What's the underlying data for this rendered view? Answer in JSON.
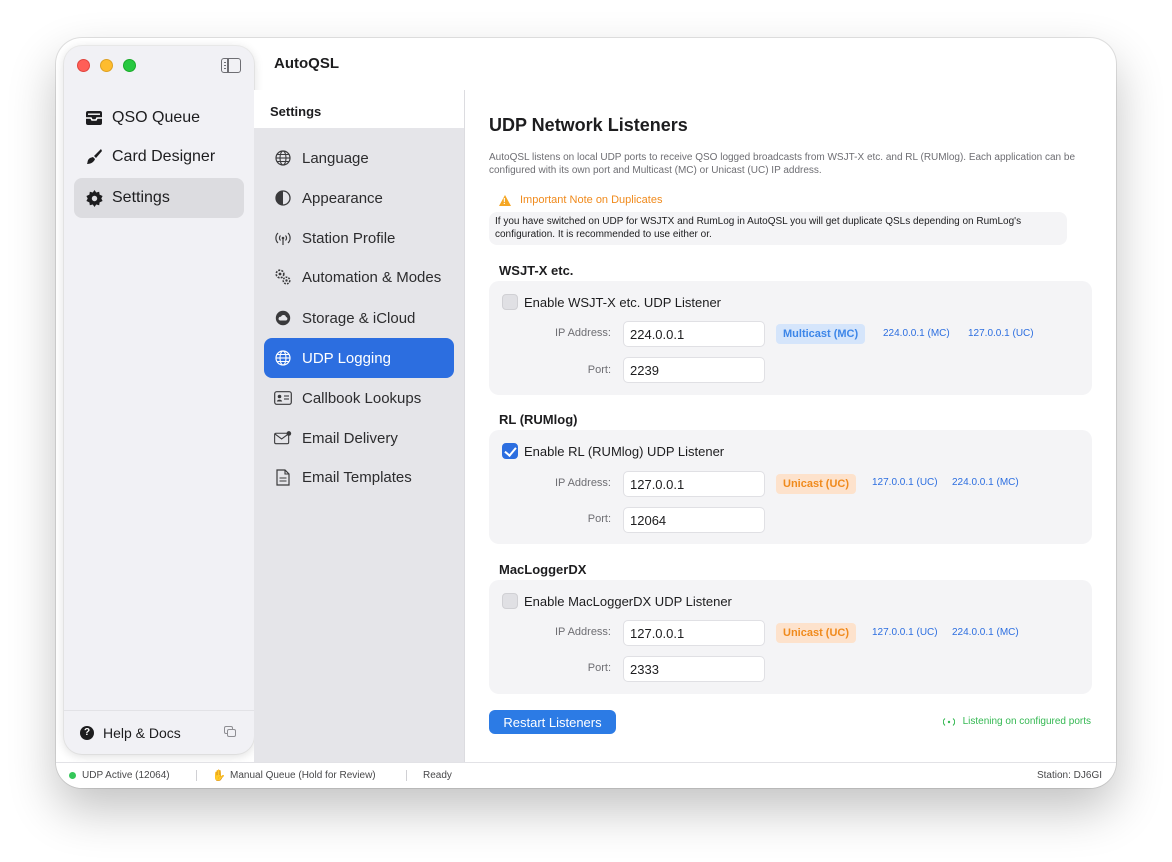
{
  "app": {
    "title": "AutoQSL"
  },
  "sidebar": {
    "items": [
      {
        "label": "QSO Queue",
        "icon": "tray-icon",
        "active": false
      },
      {
        "label": "Card Designer",
        "icon": "brush-icon",
        "active": false
      },
      {
        "label": "Settings",
        "icon": "gear-icon",
        "active": true
      }
    ],
    "footer": {
      "help_label": "Help & Docs"
    }
  },
  "settings": {
    "header": "Settings",
    "items": [
      {
        "label": "Language",
        "icon": "globe-icon"
      },
      {
        "label": "Appearance",
        "icon": "contrast-icon"
      },
      {
        "label": "Station Profile",
        "icon": "antenna-icon"
      },
      {
        "label": "Automation & Modes",
        "icon": "gears-icon"
      },
      {
        "label": "Storage & iCloud",
        "icon": "cloud-icon"
      },
      {
        "label": "UDP Logging",
        "icon": "network-icon",
        "active": true
      },
      {
        "label": "Callbook Lookups",
        "icon": "id-card-icon"
      },
      {
        "label": "Email Delivery",
        "icon": "envelope-icon"
      },
      {
        "label": "Email Templates",
        "icon": "document-icon"
      }
    ]
  },
  "main": {
    "title": "UDP Network Listeners",
    "description": "AutoQSL listens on local UDP ports to receive QSO logged broadcasts from WSJT-X etc. and RL (RUMlog). Each application can be configured with its own port and Multicast (MC) or Unicast (UC) IP address.",
    "note_title": "Important Note on Duplicates",
    "note_body": "If you have switched on UDP for WSJTX and RumLog in AutoQSL you will get duplicate QSLs depending on RumLog's configuration. It is recommended to use either or.",
    "ip_label": "IP Address:",
    "port_label": "Port:",
    "sections": [
      {
        "title": "WSJT-X etc.",
        "enable_label": "Enable WSJT-X etc. UDP Listener",
        "enabled": false,
        "ip": "224.0.0.1",
        "port": "2239",
        "mode_badge": "Multicast (MC)",
        "preset1": "224.0.0.1 (MC)",
        "preset2": "127.0.0.1 (UC)"
      },
      {
        "title": "RL (RUMlog)",
        "enable_label": "Enable RL (RUMlog) UDP Listener",
        "enabled": true,
        "ip": "127.0.0.1",
        "port": "12064",
        "mode_badge": "Unicast (UC)",
        "preset1": "127.0.0.1 (UC)",
        "preset2": "224.0.0.1 (MC)"
      },
      {
        "title": "MacLoggerDX",
        "enable_label": "Enable MacLoggerDX UDP Listener",
        "enabled": false,
        "ip": "127.0.0.1",
        "port": "2333",
        "mode_badge": "Unicast (UC)",
        "preset1": "127.0.0.1 (UC)",
        "preset2": "224.0.0.1 (MC)"
      }
    ],
    "restart_label": "Restart Listeners",
    "listening_label": "Listening on configured ports"
  },
  "status_bar": {
    "udp": "UDP Active (12064)",
    "queue": "Manual Queue (Hold for Review)",
    "state": "Ready",
    "station": "Station: DJ6GI"
  },
  "colors": {
    "accent": "#2c6ee0",
    "multicast": "#3d86e8",
    "unicast": "#f08a1c",
    "success": "#34c759"
  }
}
